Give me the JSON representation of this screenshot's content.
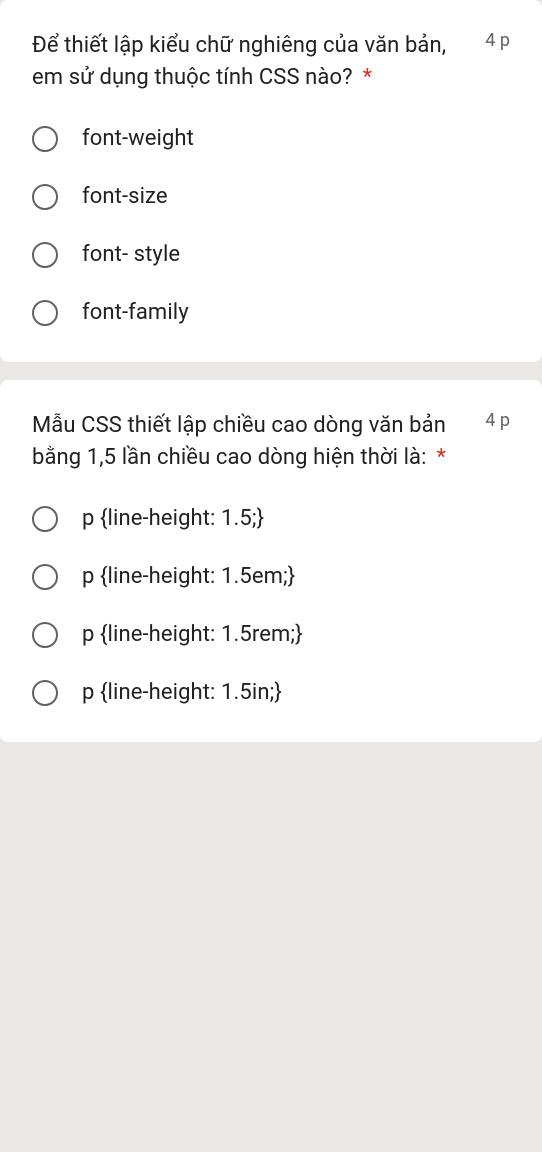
{
  "questions": [
    {
      "text": "Để thiết lập kiểu chữ nghiêng của văn bản, em sử dụng thuộc tính CSS nào?",
      "required_mark": "*",
      "points": "4 p",
      "options": [
        "font-weight",
        "font-size",
        "font- style",
        "font-family"
      ]
    },
    {
      "text": "Mẫu CSS thiết lập chiều cao dòng văn bản bằng 1,5 lần chiều cao dòng hiện thời là:",
      "required_mark": "*",
      "points": "4 p",
      "options": [
        "p {line-height: 1.5;}",
        "p {line-height: 1.5em;}",
        "p {line-height: 1.5rem;}",
        "p {line-height: 1.5in;}"
      ]
    }
  ]
}
